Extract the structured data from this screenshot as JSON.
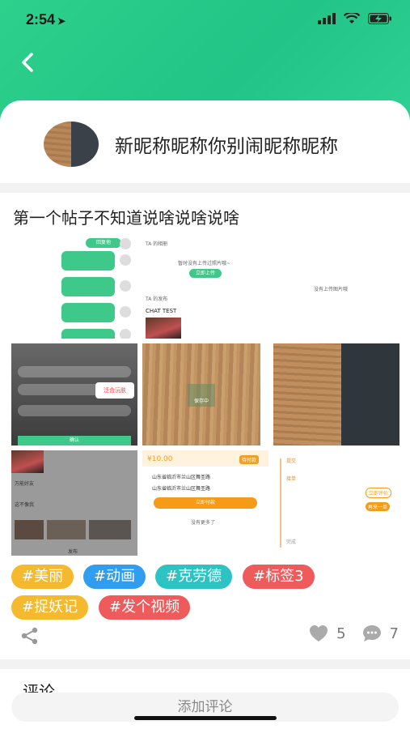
{
  "status_bar": {
    "time": "2:54"
  },
  "header": {
    "back_label": "<"
  },
  "profile": {
    "nickname": "新昵称昵称你别闹昵称昵称"
  },
  "post": {
    "title": "第一个帖子不知道说啥说啥说啥",
    "thumbnails": {
      "t1_label": "回复他",
      "t2_header1": "TA 的相册",
      "t2_text1": "暂时没有上传过照片哦~",
      "t2_button": "立即上传",
      "t2_header2": "TA 的发布",
      "t2_chat": "CHAT TEST",
      "t3_text": "没有上传图片哦",
      "t4_logo": "泛合沅肤",
      "t4_button": "确认",
      "t5_center": "保存中",
      "t7_title1": "万能好友",
      "t7_title2": "这不像我",
      "t7_bottom": "发布",
      "t8_price": "¥10.00",
      "t8_status": "待付款",
      "t8_addr1": "山东省临沂市兰山区舞圣路",
      "t8_addr2": "山东省临沂市兰山区舞圣路",
      "t8_button": "立即付款",
      "t8_more": "没有更多了",
      "t9_step1": "提交",
      "t9_step2": "接单",
      "t9_step3": "完成",
      "t9_btn1": "立即评价",
      "t9_btn2": "再来一单"
    },
    "tags": [
      "#美丽",
      "#动画",
      "#克劳德",
      "#标签3",
      "#捉妖记",
      "#发个视频"
    ],
    "tag_colors": [
      "#f5b92e",
      "#2f9ef0",
      "#2ec3c3",
      "#ef5a5a",
      "#f5b92e",
      "#ef5a5a"
    ],
    "likes": "5",
    "comments": "7"
  },
  "comments_section": {
    "heading": "评论"
  },
  "comment_input": {
    "placeholder": "添加评论"
  }
}
